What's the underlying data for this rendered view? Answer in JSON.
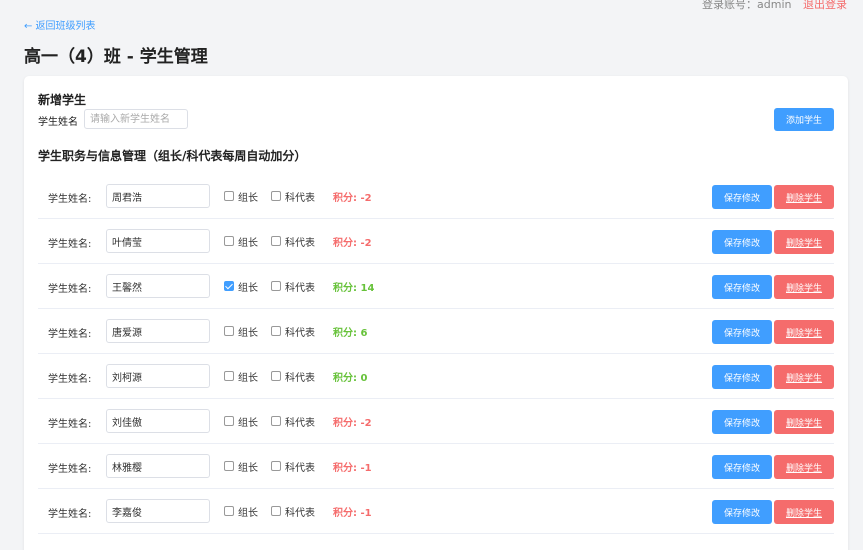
{
  "header": {
    "account_text": "登录账号：admin",
    "logout_label": "退出登录",
    "back_label": "← 返回班级列表",
    "page_title": "高一（4）班 - 学生管理"
  },
  "new_student": {
    "title": "新增学生",
    "name_label": "学生姓名",
    "name_placeholder": "请输入新学生姓名",
    "add_label": "添加学生"
  },
  "management": {
    "title": "学生职务与信息管理（组长/科代表每周自动加分）"
  },
  "colors": {
    "positive": "#67c23a",
    "negative": "#f56c6c"
  },
  "students": [
    {
      "label": "学生姓名:",
      "name": "周君浩",
      "leader": false,
      "rep": false,
      "leader_label": "组长",
      "rep_label": "科代表",
      "score_text": "积分: -2",
      "score": -2,
      "save_label": "保存修改",
      "delete_label": "删除学生"
    },
    {
      "label": "学生姓名:",
      "name": "叶倩莹",
      "leader": false,
      "rep": false,
      "leader_label": "组长",
      "rep_label": "科代表",
      "score_text": "积分: -2",
      "score": -2,
      "save_label": "保存修改",
      "delete_label": "删除学生"
    },
    {
      "label": "学生姓名:",
      "name": "王馨然",
      "leader": true,
      "rep": false,
      "leader_label": "组长",
      "rep_label": "科代表",
      "score_text": "积分: 14",
      "score": 14,
      "save_label": "保存修改",
      "delete_label": "删除学生"
    },
    {
      "label": "学生姓名:",
      "name": "唐爱源",
      "leader": false,
      "rep": false,
      "leader_label": "组长",
      "rep_label": "科代表",
      "score_text": "积分: 6",
      "score": 6,
      "save_label": "保存修改",
      "delete_label": "删除学生"
    },
    {
      "label": "学生姓名:",
      "name": "刘柯源",
      "leader": false,
      "rep": false,
      "leader_label": "组长",
      "rep_label": "科代表",
      "score_text": "积分: 0",
      "score": 0,
      "save_label": "保存修改",
      "delete_label": "删除学生"
    },
    {
      "label": "学生姓名:",
      "name": "刘佳傲",
      "leader": false,
      "rep": false,
      "leader_label": "组长",
      "rep_label": "科代表",
      "score_text": "积分: -2",
      "score": -2,
      "save_label": "保存修改",
      "delete_label": "删除学生"
    },
    {
      "label": "学生姓名:",
      "name": "林雅樱",
      "leader": false,
      "rep": false,
      "leader_label": "组长",
      "rep_label": "科代表",
      "score_text": "积分: -1",
      "score": -1,
      "save_label": "保存修改",
      "delete_label": "删除学生"
    },
    {
      "label": "学生姓名:",
      "name": "李嘉俊",
      "leader": false,
      "rep": false,
      "leader_label": "组长",
      "rep_label": "科代表",
      "score_text": "积分: -1",
      "score": -1,
      "save_label": "保存修改",
      "delete_label": "删除学生"
    }
  ]
}
